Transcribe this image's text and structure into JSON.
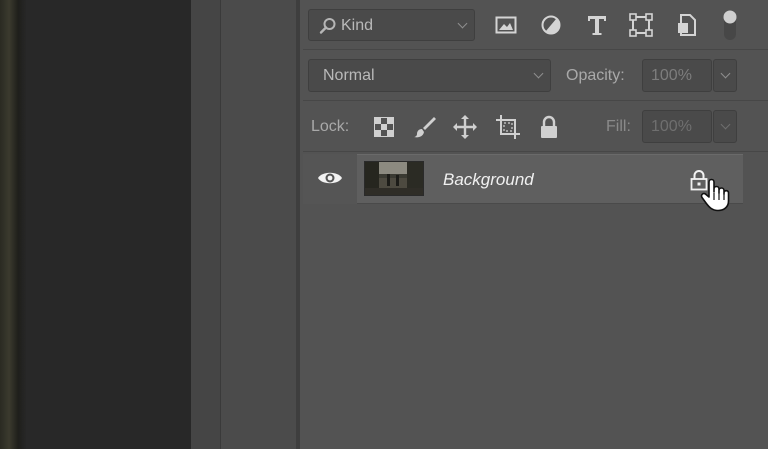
{
  "filter": {
    "placeholder": "Kind"
  },
  "blend_mode": {
    "value": "Normal"
  },
  "opacity": {
    "label": "Opacity:",
    "value": "100%"
  },
  "lock": {
    "label": "Lock:"
  },
  "fill": {
    "label": "Fill:",
    "value": "100%"
  },
  "layers": [
    {
      "name": "Background",
      "visible": true,
      "locked": true
    }
  ]
}
